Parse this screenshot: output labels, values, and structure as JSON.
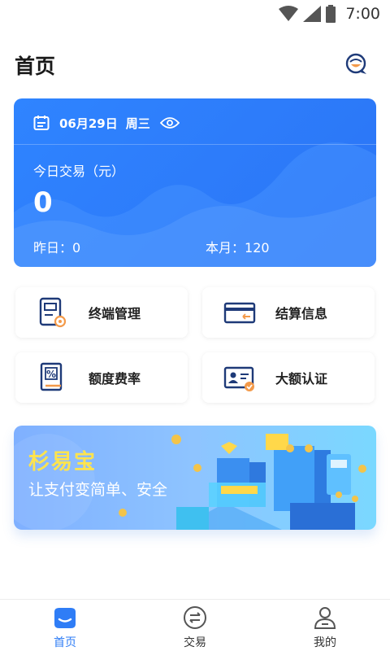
{
  "status_bar": {
    "time": "7:00"
  },
  "header": {
    "title": "首页"
  },
  "summary": {
    "date": "06月29日",
    "weekday": "周三",
    "today_label": "今日交易（元）",
    "today_value": "0",
    "yesterday_label": "昨日：",
    "yesterday_value": "0",
    "month_label": "本月：",
    "month_value": "120"
  },
  "tiles": [
    {
      "label": "终端管理",
      "icon": "terminal-gear-icon"
    },
    {
      "label": "结算信息",
      "icon": "card-transfer-icon"
    },
    {
      "label": "额度费率",
      "icon": "percent-doc-icon"
    },
    {
      "label": "大额认证",
      "icon": "id-card-check-icon"
    }
  ],
  "banner": {
    "title": "杉易宝",
    "subtitle": "让支付变简单、安全"
  },
  "nav": [
    {
      "label": "首页",
      "icon": "home-icon",
      "active": true
    },
    {
      "label": "交易",
      "icon": "exchange-icon",
      "active": false
    },
    {
      "label": "我的",
      "icon": "user-icon",
      "active": false
    }
  ],
  "colors": {
    "primary": "#2f7df6",
    "card_blue": "#2b74f5",
    "icon_navy": "#1e3a78",
    "icon_orange": "#f39a4a",
    "banner_yellow": "#ffe44d"
  }
}
